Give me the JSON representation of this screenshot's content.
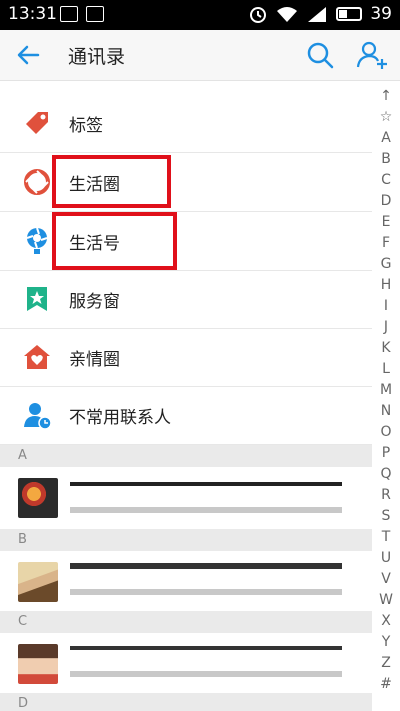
{
  "status_bar": {
    "time": "13:31",
    "battery": "39"
  },
  "header": {
    "title": "通讯录"
  },
  "entries": [
    {
      "label": "标签",
      "icon": "tag-icon",
      "color": "#e0513c"
    },
    {
      "label": "生活圈",
      "icon": "life-circle-icon",
      "color": "#e0513c"
    },
    {
      "label": "生活号",
      "icon": "life-account-icon",
      "color": "#1e8fe1"
    },
    {
      "label": "服务窗",
      "icon": "service-window-icon",
      "color": "#1fb38a"
    },
    {
      "label": "亲情圈",
      "icon": "family-circle-icon",
      "color": "#e0513c"
    },
    {
      "label": "不常用联系人",
      "icon": "inactive-contact-icon",
      "color": "#1e8fe1"
    }
  ],
  "sections": [
    {
      "letter": "A"
    },
    {
      "letter": "B"
    },
    {
      "letter": "C"
    },
    {
      "letter": "D"
    }
  ],
  "index_letters": [
    "↑",
    "☆",
    "A",
    "B",
    "C",
    "D",
    "E",
    "F",
    "G",
    "H",
    "I",
    "J",
    "K",
    "L",
    "M",
    "N",
    "O",
    "P",
    "Q",
    "R",
    "S",
    "T",
    "U",
    "V",
    "W",
    "X",
    "Y",
    "Z",
    "#"
  ],
  "colors": {
    "accent": "#1e8fe1",
    "highlight": "#e0101a"
  }
}
